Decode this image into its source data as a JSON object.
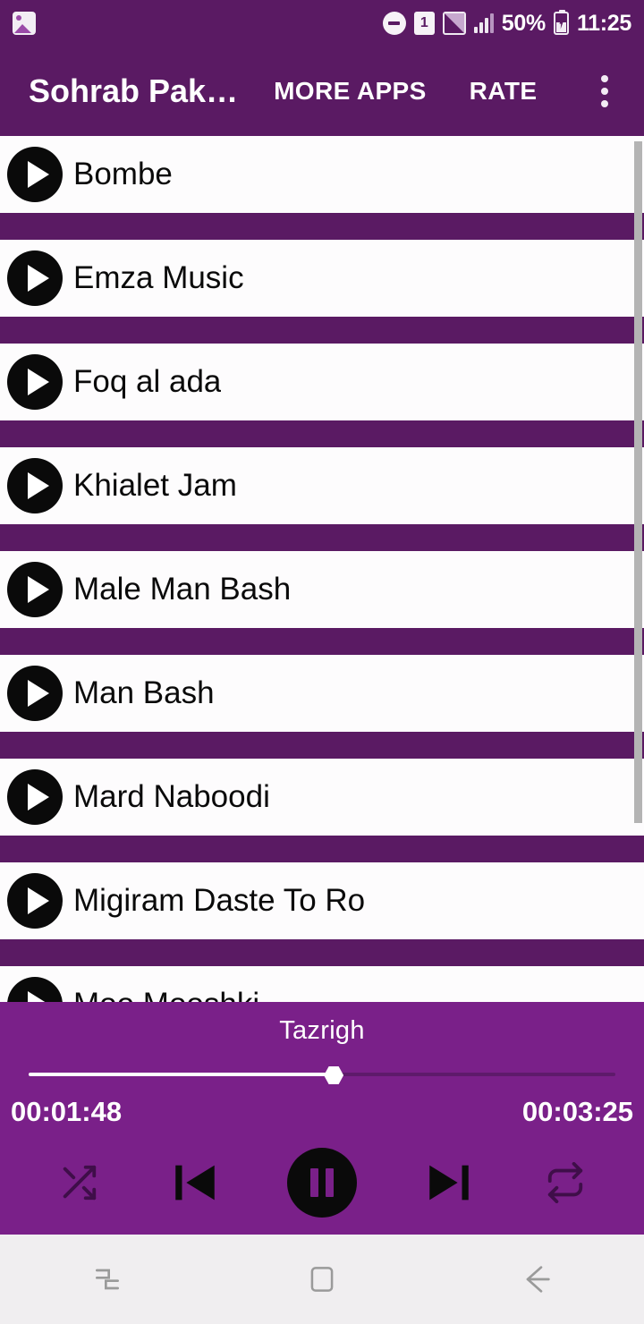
{
  "status_bar": {
    "left_icons": [
      {
        "name": "photo-notification-icon",
        "label": "image"
      }
    ],
    "right_icons": [
      {
        "name": "do-not-disturb-icon",
        "label": "do-not-disturb"
      },
      {
        "name": "sim-card-icon",
        "label": "1"
      },
      {
        "name": "signal-box-icon",
        "label": "signal"
      },
      {
        "name": "signal-bars-icon",
        "label": "bars"
      }
    ],
    "battery_percent": "50%",
    "battery_charging": true,
    "time": "11:25"
  },
  "app_bar": {
    "title": "Sohrab Pak…",
    "more_apps_label": "MORE APPS",
    "rate_label": "RATE",
    "overflow_label": "overflow-menu"
  },
  "song_list": {
    "items": [
      {
        "title": "Bombe"
      },
      {
        "title": "Emza Music"
      },
      {
        "title": "Foq al ada"
      },
      {
        "title": "Khialet Jam"
      },
      {
        "title": "Male Man Bash"
      },
      {
        "title": "Man Bash"
      },
      {
        "title": "Mard Naboodi"
      },
      {
        "title": "Migiram Daste To Ro"
      },
      {
        "title": "Moo Mooshki"
      }
    ]
  },
  "player": {
    "now_playing": "Tazrigh",
    "elapsed": "00:01:48",
    "duration": "00:03:25",
    "progress_percent": 52,
    "controls": {
      "shuffle": "shuffle",
      "previous": "previous",
      "play_pause": "pause",
      "next": "next",
      "repeat": "repeat"
    }
  },
  "nav_bar": {
    "recents": "recents",
    "home": "home",
    "back": "back"
  },
  "colors": {
    "app_bar_purple": "#5a1a63",
    "player_purple": "#7a2089",
    "row_white": "#fdfcfd",
    "nav_gray": "#f0eef0",
    "icon_black": "#0a0a0a",
    "muted_control": "#3f0e49",
    "scrollbar": "#b4b4b4"
  }
}
